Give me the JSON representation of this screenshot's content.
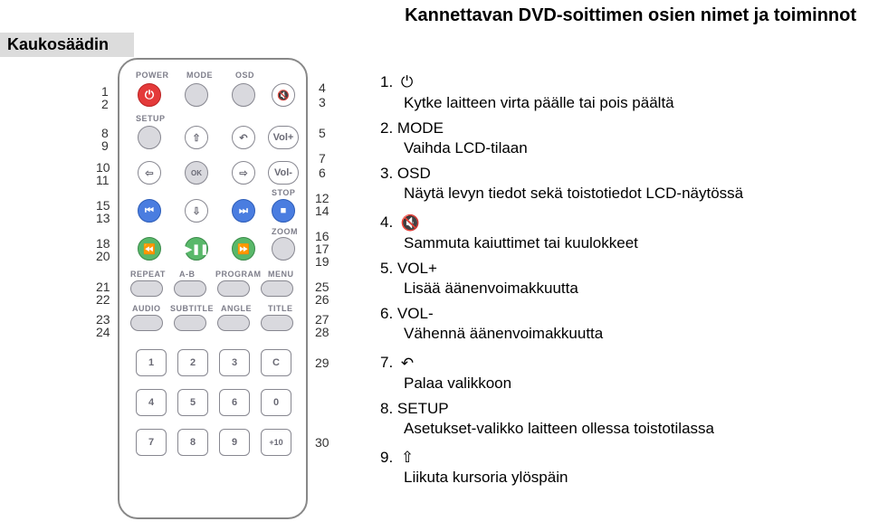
{
  "page_title": "Kannettavan DVD-soittimen osien nimet ja toiminnot",
  "section_label": "Kaukosäädin",
  "remote_labels": {
    "row1": [
      "POWER",
      "MODE",
      "OSD"
    ],
    "row2": [
      "SETUP"
    ],
    "vol_plus": "Vol+",
    "vol_minus": "Vol-",
    "stop": "STOP",
    "zoom": "ZOOM",
    "row5": [
      "REPEAT",
      "A-B",
      "PROGRAM",
      "MENU"
    ],
    "row6": [
      "AUDIO",
      "SUBTITLE",
      "ANGLE",
      "TITLE"
    ],
    "numpad": [
      "1",
      "2",
      "3",
      "C",
      "4",
      "5",
      "6",
      "0",
      "7",
      "8",
      "9",
      "+10"
    ]
  },
  "callouts_left": [
    "1",
    "2",
    "8",
    "9",
    "10",
    "11",
    "15",
    "13",
    "18",
    "20",
    "21",
    "22",
    "23",
    "24"
  ],
  "callouts_right": [
    "4",
    "3",
    "5",
    "7",
    "6",
    "12",
    "14",
    "16",
    "17",
    "19",
    "25",
    "26",
    "27",
    "28",
    "29",
    "30"
  ],
  "instructions": [
    {
      "no": "1.",
      "icon": "power",
      "head": "",
      "desc": "Kytke laitteen virta päälle tai pois päältä"
    },
    {
      "no": "2.",
      "icon": "",
      "head": "MODE",
      "desc": "Vaihda LCD-tilaan"
    },
    {
      "no": "3.",
      "icon": "",
      "head": "OSD",
      "desc": "Näytä levyn tiedot sekä toistotiedot LCD-näytössä"
    },
    {
      "no": "4.",
      "icon": "mute",
      "head": "",
      "desc": "Sammuta kaiuttimet tai kuulokkeet"
    },
    {
      "no": "5.",
      "icon": "",
      "head": "VOL+",
      "desc": "Lisää äänenvoimakkuutta"
    },
    {
      "no": "6.",
      "icon": "",
      "head": "VOL-",
      "desc": "Vähennä äänenvoimakkuutta"
    },
    {
      "no": "7.",
      "icon": "return",
      "head": "",
      "desc": "Palaa valikkoon"
    },
    {
      "no": "8.",
      "icon": "",
      "head": "SETUP",
      "desc": "Asetukset-valikko laitteen ollessa toistotilassa"
    },
    {
      "no": "9.",
      "icon": "up",
      "head": "",
      "desc": "Liikuta kursoria ylöspäin"
    }
  ]
}
